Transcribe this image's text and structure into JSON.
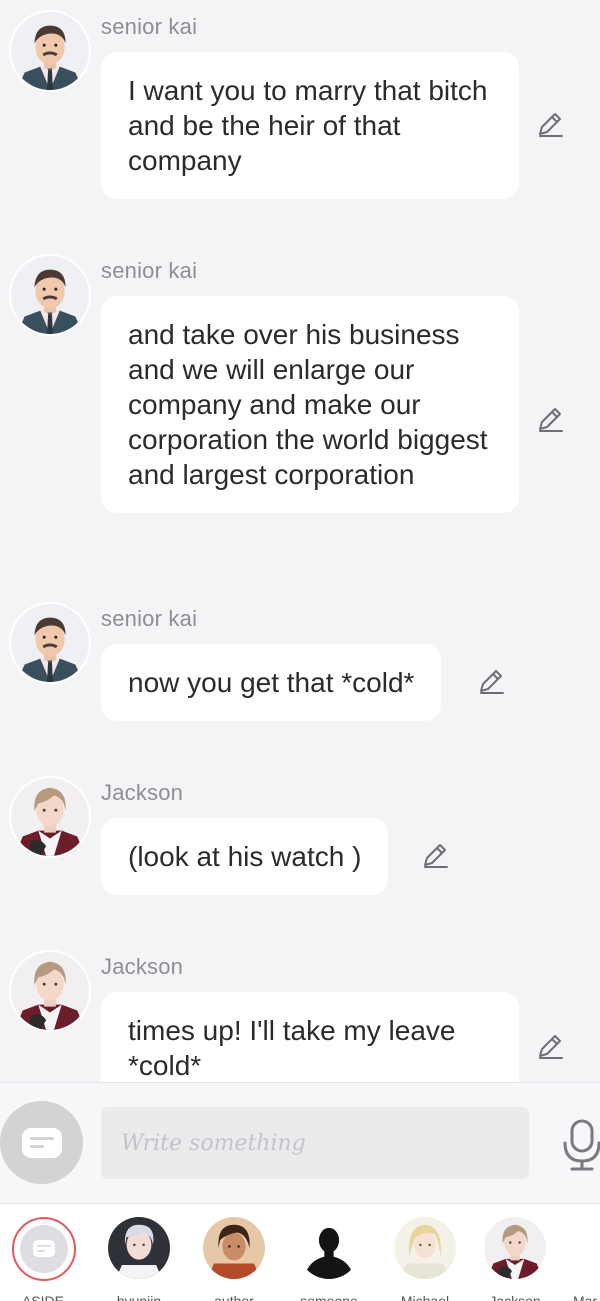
{
  "messages": [
    {
      "sender": "senior kai",
      "text": "I want you to marry that bitch and be the heir of that company",
      "avatar": "senior-kai-avatar"
    },
    {
      "sender": "senior kai",
      "text": "and take over his business and we will enlarge our company and make our corporation the world biggest and largest corporation",
      "avatar": "senior-kai-avatar"
    },
    {
      "sender": "senior kai",
      "text": "now you get that *cold*",
      "avatar": "senior-kai-avatar"
    },
    {
      "sender": "Jackson",
      "text": "(look at his watch )",
      "avatar": "jackson-avatar"
    },
    {
      "sender": "Jackson",
      "text": "times up! I'll take my leave *cold*",
      "avatar": "jackson-avatar"
    }
  ],
  "composer": {
    "placeholder": "Write something",
    "aside_icon": "aside-chat-icon",
    "mic_icon": "microphone-icon"
  },
  "characters": [
    {
      "name": "ASIDE",
      "selected": true
    },
    {
      "name": "hyunjin"
    },
    {
      "name": "author"
    },
    {
      "name": "someone"
    },
    {
      "name": "Michael"
    },
    {
      "name": "Jackson"
    },
    {
      "name": "Mar"
    }
  ],
  "colors": {
    "background": "#f4f4f6",
    "bubble": "#ffffff",
    "text": "#2b2b2b",
    "sender": "#8e8e93",
    "accent_selected": "#e5585c"
  }
}
